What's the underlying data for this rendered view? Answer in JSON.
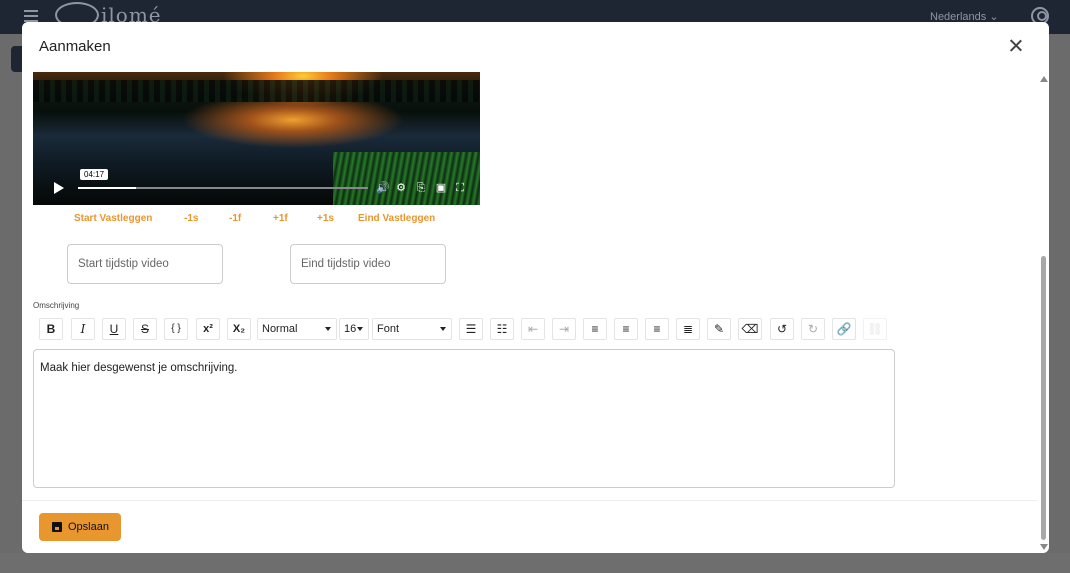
{
  "app": {
    "brand": "ilomé",
    "language": "Nederlands"
  },
  "modal": {
    "title": "Aanmaken"
  },
  "video": {
    "current_time": "04:17",
    "progress": 0.2
  },
  "capture": {
    "start": "Start Vastleggen",
    "minus_second": "-1s",
    "minus_frame": "-1f",
    "plus_frame": "+1f",
    "plus_second": "+1s",
    "end": "Eind Vastleggen"
  },
  "inputs": {
    "start_placeholder": "Start tijdstip video",
    "end_placeholder": "Eind tijdstip video"
  },
  "description": {
    "label": "Omschrijving",
    "toolbar": {
      "bold": "B",
      "italic": "I",
      "underline": "U",
      "strike": "S",
      "code": "{ }",
      "superscript": "x²",
      "subscript": "X₂",
      "paragraph_style": "Normal",
      "font_size": "16",
      "font_family": "Font"
    },
    "text": "Maak hier desgewenst je omschrijving."
  },
  "footer": {
    "save_label": "Opslaan"
  }
}
